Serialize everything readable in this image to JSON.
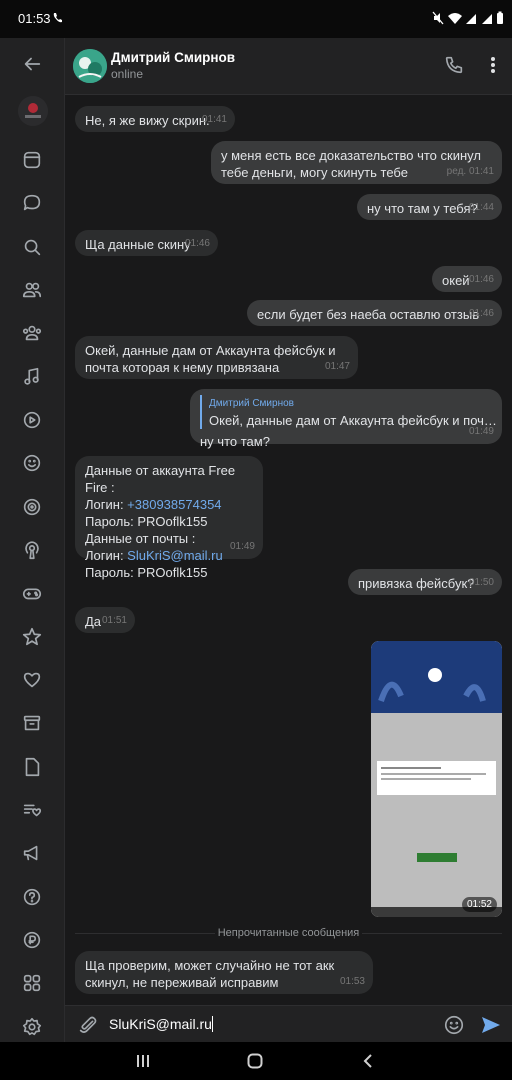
{
  "status_bar": {
    "time": "01:53"
  },
  "sidebar": {
    "items": [
      "back-icon",
      "news-icon",
      "messages-icon",
      "search-icon",
      "friends-icon",
      "communities-icon",
      "music-icon",
      "video-icon",
      "stickers-icon",
      "games-icon",
      "podcast-icon",
      "gamepad-icon",
      "star-icon",
      "heart-icon",
      "archive-icon",
      "documents-icon",
      "bookmarks-icon",
      "ads-icon",
      "help-icon",
      "payments-icon",
      "services-icon",
      "settings-icon"
    ]
  },
  "header": {
    "name": "Дмитрий Смирнов",
    "status": "online"
  },
  "messages": [
    {
      "text": "Не, я же вижу скрин.",
      "time": "01:41"
    },
    {
      "text": "у меня есть все доказательство что скинул тебе деньги, могу скинуть тебе",
      "time": "ред. 01:41"
    },
    {
      "text": "ну что там у тебя?",
      "time": "01:44"
    },
    {
      "text": "Ща данные скину",
      "time": "01:46"
    },
    {
      "text": "окей",
      "time": "01:46"
    },
    {
      "text": "если будет без наеба оставлю отзыв",
      "time": "01:46"
    },
    {
      "text": "Окей, данные дам от Аккаунта фейсбук и почта которая к нему привязана",
      "time": "01:47"
    },
    {
      "reply_name": "Дмитрий Смирнов",
      "reply_text": "Окей, данные дам от Аккаунта фейсбук и почта кот...",
      "text": "ну что там?",
      "time": "01:49"
    },
    {
      "line1": "Данные от аккаунта Free Fire :",
      "line2_label": "Логин: ",
      "line2_link": "+380938574354",
      "line3": "Пароль: PROoflk155",
      "line4": "Данные от почты :",
      "line5_label": "Логин: ",
      "line5_link": "SluKriS@mail.ru",
      "line6": "Пароль: PROoflk155",
      "time": "01:49"
    },
    {
      "text": "привязка фейсбук?",
      "time": "01:50"
    },
    {
      "text": "Да",
      "time": "01:51"
    },
    {
      "photo_time": "01:52"
    },
    {
      "text": "Ща проверим, может случайно не тот акк скинул, не переживай исправим",
      "time": "01:53"
    }
  ],
  "unread_divider": "Непрочитанные сообщения",
  "composer": {
    "value": "SluKriS@mail.ru"
  },
  "colors": {
    "link": "#71aaeb",
    "send": "#71aaeb"
  }
}
